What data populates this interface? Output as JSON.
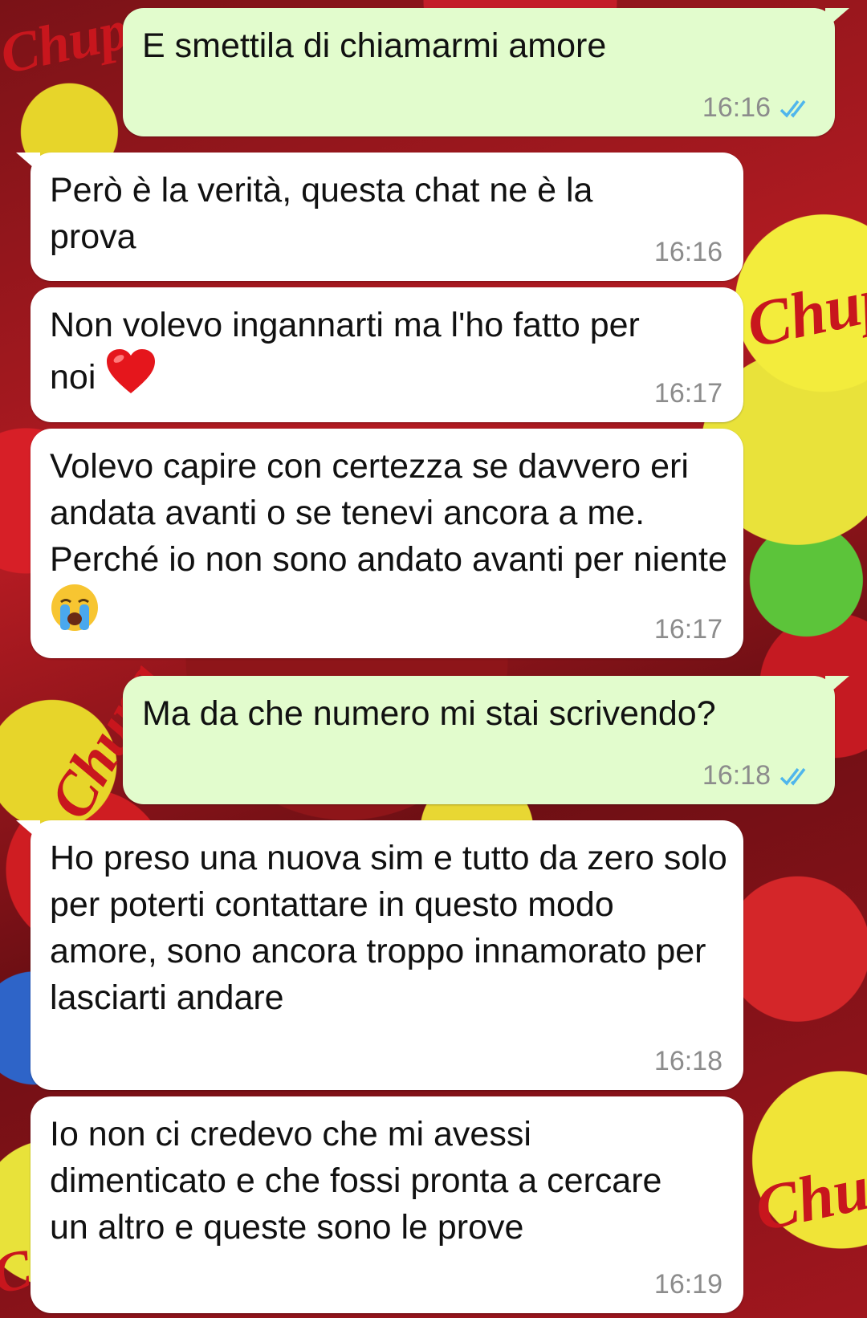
{
  "messages": [
    {
      "id": "m1",
      "direction": "out",
      "text": "E smettila di chiamarmi amore",
      "time": "16:16",
      "status": "read"
    },
    {
      "id": "m2",
      "direction": "in",
      "text": "Però è la verità, questa chat ne è la prova",
      "time": "16:16"
    },
    {
      "id": "m3",
      "direction": "in",
      "text": "Non volevo ingannarti ma l'ho fatto per noi",
      "emoji": "red-heart",
      "time": "16:17"
    },
    {
      "id": "m4",
      "direction": "in",
      "text": "Volevo capire con certezza se davvero eri andata avanti o se tenevi ancora a me. Perché io non sono andato avanti per niente",
      "emoji": "loudly-crying-face",
      "time": "16:17"
    },
    {
      "id": "m5",
      "direction": "out",
      "text": "Ma da che numero mi stai scrivendo?",
      "time": "16:18",
      "status": "read"
    },
    {
      "id": "m6",
      "direction": "in",
      "text": "Ho preso una nuova sim e tutto da zero solo per poterti contattare in questo modo amore, sono ancora troppo innamorato per lasciarti andare",
      "time": "16:18"
    },
    {
      "id": "m7",
      "direction": "in",
      "text": "Io non ci credevo che mi avessi dimenticato e che fossi pronta a cercare un altro e queste sono le prove",
      "time": "16:19"
    }
  ],
  "wallpaper_text": [
    "Chupa",
    "Chups",
    "Chupa",
    "Chupa",
    "Chupa"
  ],
  "colors": {
    "outgoing": "#e2fccd",
    "incoming": "#ffffff",
    "read_ticks": "#4fb6ec",
    "time": "#8c8c8c"
  }
}
